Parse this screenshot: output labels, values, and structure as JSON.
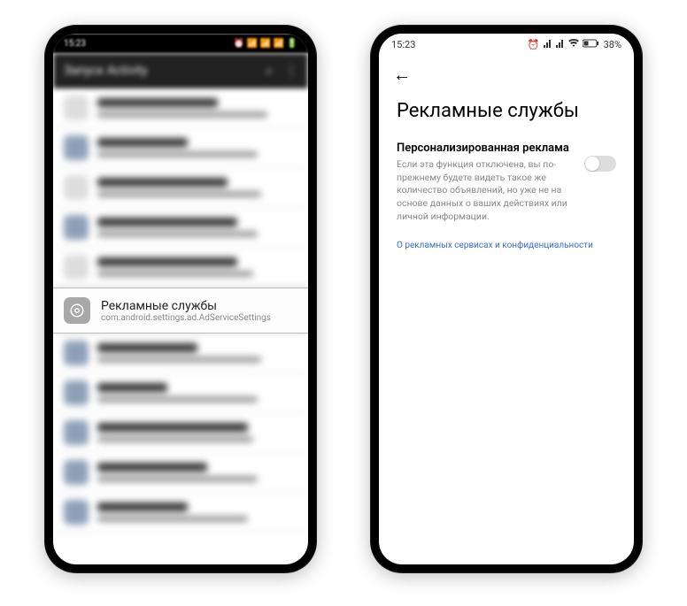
{
  "left": {
    "statusbar": {
      "time": "15:23",
      "icons": "⏰ 📶 📶 📶 🔋"
    },
    "header": {
      "title": "Запуск Activity",
      "search_icon": "search-icon",
      "menu_icon": "menu-icon"
    },
    "blur_rows": [
      {
        "title_w": "60%",
        "sub_w": "85%",
        "icon": false
      },
      {
        "title_w": "45%",
        "sub_w": "80%",
        "icon": true
      },
      {
        "title_w": "65%",
        "sub_w": "82%",
        "icon": false
      },
      {
        "title_w": "70%",
        "sub_w": "80%",
        "icon": true
      },
      {
        "title_w": "70%",
        "sub_w": "78%",
        "icon": false
      }
    ],
    "focused": {
      "title": "Рекламные службы",
      "sub": "com.android.settings.ad.AdServiceSettings"
    },
    "blur_rows_after": [
      {
        "title_w": "50%",
        "sub_w": "82%",
        "icon": true
      },
      {
        "title_w": "35%",
        "sub_w": "80%",
        "icon": true
      },
      {
        "title_w": "75%",
        "sub_w": "78%",
        "icon": true
      },
      {
        "title_w": "55%",
        "sub_w": "80%",
        "icon": true
      },
      {
        "title_w": "45%",
        "sub_w": "75%",
        "icon": true
      }
    ]
  },
  "right": {
    "statusbar": {
      "time": "15:23",
      "battery": "38%"
    },
    "page_title": "Рекламные службы",
    "setting": {
      "title": "Персонализированная реклама",
      "desc": "Если эта функция отключена, вы по-прежнему будете видеть такое же количество объявлений, но уже не на основе данных о ваших действиях или личной информации.",
      "toggle_on": false
    },
    "privacy_link": "О рекламных сервисах и конфиденциальности"
  }
}
